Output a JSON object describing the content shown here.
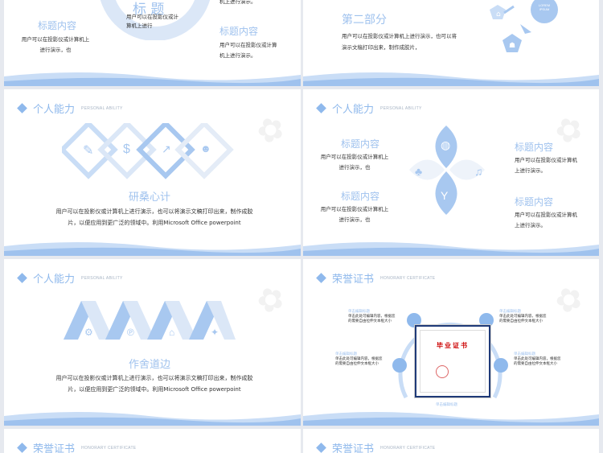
{
  "slide1": {
    "title_center": "标 题",
    "center_body": "用户可以在投影仪或计算机上进行",
    "left_title": "标题内容",
    "left_body": "用户可以在投影仪或计算机上进行演示，也",
    "right_title": "标题内容",
    "right_body": "用户可以在投影仪或计算机上进行演示。",
    "top_right_partial": "机上进行演示。"
  },
  "slide2": {
    "section_title": "第二部分",
    "body": "用户可以在投影仪或计算机上进行演示，也可以将演示文稿打印出来，制作成胶片，",
    "bubble_text": "LOREM IPSUM"
  },
  "slide3": {
    "header_title": "个人能力",
    "header_sub": "PERSONAL ABILITY",
    "title": "研桑心计",
    "body": "用户可以在投影仪或计算机上进行演示，也可以将演示文稿打印出来，制作成胶片，以便应用到更广泛的领域中。利用Microsoft Office powerpoint",
    "icons": [
      "edit-icon",
      "money-bag-icon",
      "chart-up-icon",
      "team-icon"
    ]
  },
  "slide4": {
    "header_title": "个人能力",
    "header_sub": "PERSONAL ABILITY",
    "items": [
      {
        "title": "标题内容",
        "body": "用户可以在投影仪或计算机上进行演示，也"
      },
      {
        "title": "标题内容",
        "body": "用户可以在投影仪或计算机上进行演示，也"
      },
      {
        "title": "标题内容",
        "body": "用户可以在投影仪或计算机上进行演示。"
      },
      {
        "title": "标题内容",
        "body": "用户可以在投影仪或计算机上进行演示。"
      }
    ]
  },
  "slide5": {
    "header_title": "个人能力",
    "header_sub": "PERSONAL ABILITY",
    "title": "作舍道边",
    "body": "用户可以在投影仪或计算机上进行演示，也可以将演示文稿打印出来，制作成胶片，以便应用到更广泛的领域中。利用Microsoft Office powerpoint"
  },
  "slide6": {
    "header_title": "荣誉证书",
    "header_sub": "HONORARY CERTIFICATE",
    "cert_title": "毕业证书",
    "labels": [
      {
        "title": "单击编辑标题",
        "body": "单击此处可编辑内容，根据您的需要自由拉伸文本框大小"
      },
      {
        "title": "单击编辑标题",
        "body": "单击此处可编辑内容，根据您的需要自由拉伸文本框大小"
      },
      {
        "title": "单击编辑标题",
        "body": "单击此处可编辑内容，根据您的需要自由拉伸文本框大小"
      },
      {
        "title": "单击编辑标题",
        "body": "单击此处可编辑内容，根据您的需要自由拉伸文本框大小"
      }
    ],
    "bottom_label": "单击编辑标题"
  },
  "slide7": {
    "header_title": "荣誉证书",
    "header_sub": "HONORARY CERTIFICATE"
  },
  "slide8": {
    "header_title": "荣誉证书",
    "header_sub": "HONORARY CERTIFICATE"
  },
  "colors": {
    "accent": "#8fb9ec",
    "accent_light": "#c9ddf6",
    "text": "#333333"
  }
}
